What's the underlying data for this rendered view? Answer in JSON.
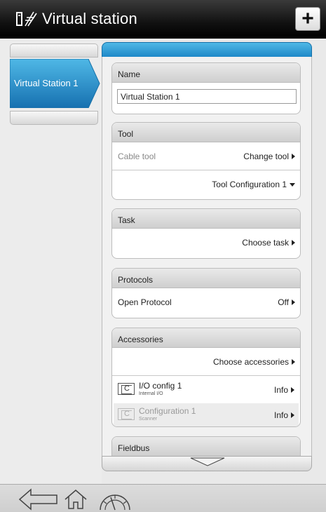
{
  "header": {
    "title": "Virtual station",
    "add_label": "+",
    "app_icon": "tools-icon"
  },
  "left": {
    "station_tab_label": "Virtual Station 1"
  },
  "sections": {
    "name": {
      "title": "Name",
      "input_value": "Virtual Station 1"
    },
    "tool": {
      "title": "Tool",
      "tool_name": "Cable tool",
      "change_tool": "Change tool",
      "config": "Tool Configuration 1"
    },
    "task": {
      "title": "Task",
      "choose_task": "Choose task"
    },
    "protocols": {
      "title": "Protocols",
      "protocol_name": "Open Protocol",
      "protocol_value": "Off"
    },
    "accessories": {
      "title": "Accessories",
      "choose": "Choose accessories",
      "items": [
        {
          "icon_letter": "C",
          "name": "I/O config 1",
          "sub": "Internal I/O",
          "action": "Info"
        },
        {
          "icon_letter": "C",
          "name": "Configuration 1",
          "sub": "Scanner",
          "action": "Info"
        }
      ]
    },
    "fieldbus": {
      "title": "Fieldbus"
    }
  },
  "footer": {
    "icons": [
      "back-arrow-icon",
      "home-icon",
      "gauge-icon"
    ]
  },
  "colors": {
    "accent_blue": "#1e88c8",
    "header_bg": "#000000"
  }
}
